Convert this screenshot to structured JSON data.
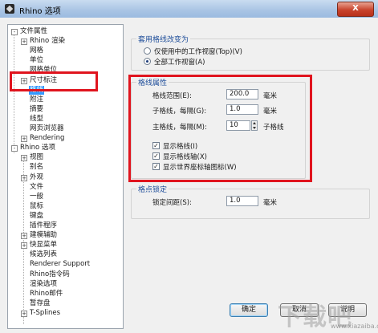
{
  "window": {
    "title": "Rhino 选项",
    "close_label": "X"
  },
  "tree": {
    "items": [
      {
        "label": "文件属性",
        "expander": "-"
      },
      {
        "label": "Rhino 渲染",
        "expander": "+"
      },
      {
        "label": "网格",
        "expander": ""
      },
      {
        "label": "单位",
        "expander": ""
      },
      {
        "label": "网格单位",
        "expander": ""
      },
      {
        "label": "尺寸标注",
        "expander": "+"
      },
      {
        "label": "格线",
        "expander": "",
        "selected": true
      },
      {
        "label": "附注",
        "expander": ""
      },
      {
        "label": "摘要",
        "expander": ""
      },
      {
        "label": "线型",
        "expander": ""
      },
      {
        "label": "网页浏览器",
        "expander": ""
      },
      {
        "label": "Rendering",
        "expander": "+"
      },
      {
        "label": "Rhino 选项",
        "expander": "-"
      },
      {
        "label": "视图",
        "expander": "+"
      },
      {
        "label": "别名",
        "expander": ""
      },
      {
        "label": "外观",
        "expander": "+"
      },
      {
        "label": "文件",
        "expander": ""
      },
      {
        "label": "一般",
        "expander": ""
      },
      {
        "label": "鼠标",
        "expander": ""
      },
      {
        "label": "键盘",
        "expander": ""
      },
      {
        "label": "插件程序",
        "expander": ""
      },
      {
        "label": "建模辅助",
        "expander": "+"
      },
      {
        "label": "快显菜单",
        "expander": "+"
      },
      {
        "label": "候选列表",
        "expander": ""
      },
      {
        "label": "Renderer Support",
        "expander": ""
      },
      {
        "label": "Rhino指令码",
        "expander": ""
      },
      {
        "label": "渲染选项",
        "expander": ""
      },
      {
        "label": "Rhino邮件",
        "expander": ""
      },
      {
        "label": "暂存盘",
        "expander": ""
      },
      {
        "label": "T-Splines",
        "expander": "+"
      }
    ]
  },
  "apply_to": {
    "title": "套用格线改变为",
    "options": [
      {
        "label": "仅使用中的工作视窗(Top)(V)",
        "checked": false
      },
      {
        "label": "全部工作视窗(A)",
        "checked": true
      }
    ]
  },
  "grid_properties": {
    "title": "格线属性",
    "extent_label": "格线范围(E):",
    "extent_value": "200.0",
    "extent_unit": "毫米",
    "minor_label": "子格线，每隔(G):",
    "minor_value": "1.0",
    "minor_unit": "毫米",
    "major_label": "主格线，每隔(M):",
    "major_value": "10",
    "major_unit": "子格线",
    "checkboxes": [
      {
        "label": "显示格线(I)",
        "checked": true
      },
      {
        "label": "显示格线轴(X)",
        "checked": true
      },
      {
        "label": "显示世界座标轴图标(W)",
        "checked": true
      }
    ]
  },
  "snap": {
    "title": "格点锁定",
    "spacing_label": "锁定间距(S):",
    "spacing_value": "1.0",
    "spacing_unit": "毫米"
  },
  "buttons": {
    "ok": "确定",
    "cancel": "取消",
    "help": "说明"
  },
  "watermark": {
    "logo": "下载吧",
    "url": "www.xiazaiba.com"
  },
  "colors": {
    "highlight_frame": "#e0141e",
    "selection": "#3399ff"
  }
}
